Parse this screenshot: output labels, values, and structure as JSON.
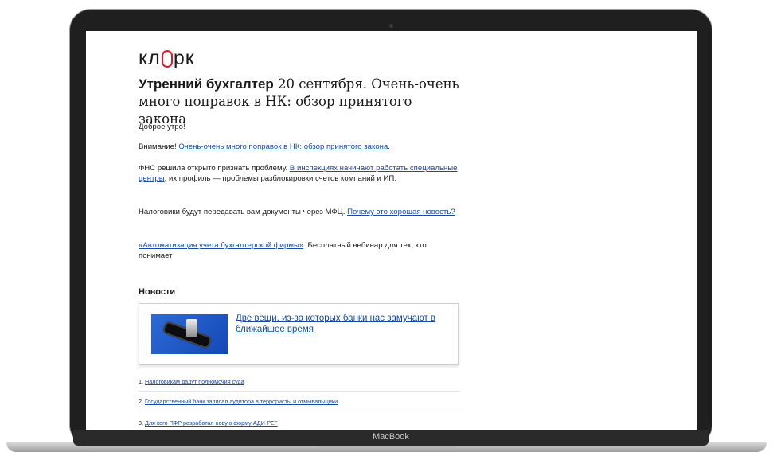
{
  "device": {
    "label": "MacBook"
  },
  "email": {
    "logo": {
      "text_left": "кл",
      "text_right": "рк"
    },
    "headline": {
      "bold": "Утренний бухгалтер",
      "rest": " 20 сентября. Очень-очень много поправок в НК: обзор принятого закона"
    },
    "greeting": "Доброе утро!",
    "attention": {
      "prefix": "Внимание! ",
      "link": "Очень-очень много поправок в НК: обзор принятого закона",
      "suffix": "."
    },
    "fns": {
      "prefix": "ФНС решила открыто признать проблему. ",
      "link": "В инспекциях начинают работать специальные центры",
      "suffix": ", их профиль — проблемы разблокировки счетов компаний и ИП."
    },
    "mfc": {
      "prefix": "Налоговики будут передавать вам документы через МФЦ. ",
      "link": "Почему это хорошая новость?"
    },
    "webinar": {
      "link": "«Автоматизация учета бухгалтерской фирмы»",
      "suffix": ". Бесплатный вебинар для тех, кто понимает"
    },
    "news_heading": "Новости",
    "featured": {
      "title": "Две вещи, из-за которых банки нас замучают в ближайшее время"
    },
    "list": [
      {
        "num": "1. ",
        "title": "Налоговикам дадут полномочия суда"
      },
      {
        "num": "2. ",
        "title": "Государственный банк записал аудитора в террористы и отмывальщики"
      },
      {
        "num": "3. ",
        "title": "Для кого ПФР разработал новую форму АДИ-РЕГ"
      }
    ]
  }
}
